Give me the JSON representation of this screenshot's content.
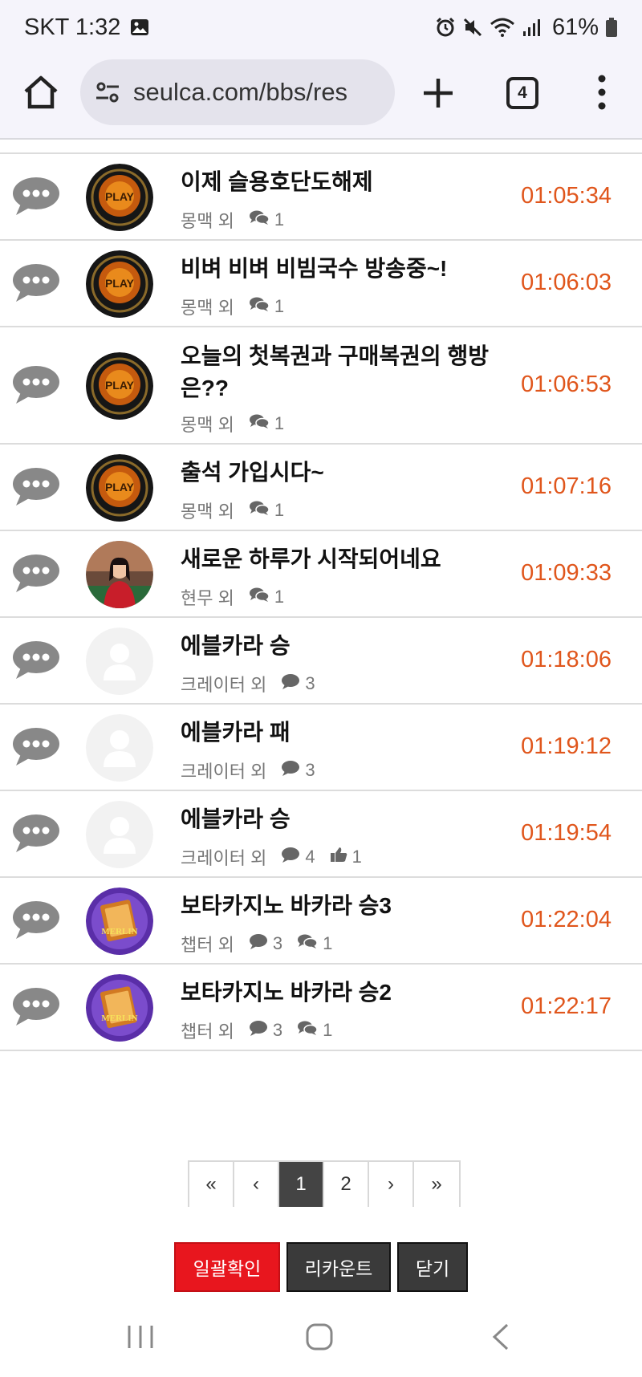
{
  "status_bar": {
    "time": "SKT 1:32",
    "battery": "61%",
    "icons": [
      "gallery-icon",
      "alarm-icon",
      "mute-icon",
      "wifi-icon",
      "signal-icon",
      "battery-icon"
    ]
  },
  "browser": {
    "url": "seulca.com/bbs/res",
    "tab_count": "4"
  },
  "posts": [
    {
      "title": "이제 슬용호단도해제",
      "author": "몽맥 외",
      "comments": "1",
      "comment_icon": "speech-bubbles-icon",
      "extra": null,
      "time": "01:05:34",
      "avatar": "play-logo",
      "height": 108
    },
    {
      "title": "비벼 비벼 비빔국수 방송중~!",
      "author": "몽맥 외",
      "comments": "1",
      "comment_icon": "speech-bubbles-icon",
      "extra": null,
      "time": "01:06:03",
      "avatar": "play-logo",
      "height": 108
    },
    {
      "title": "오늘의 첫복권과 구매복권의 행방은??",
      "author": "몽맥 외",
      "comments": "1",
      "comment_icon": "speech-bubbles-icon",
      "extra": null,
      "time": "01:06:53",
      "avatar": "play-logo",
      "height": 146
    },
    {
      "title": "출석 가입시다~",
      "author": "몽맥 외",
      "comments": "1",
      "comment_icon": "speech-bubbles-icon",
      "extra": null,
      "time": "01:07:16",
      "avatar": "play-logo",
      "height": 108
    },
    {
      "title": "새로운 하루가 시작되어네요",
      "author": "현무 외",
      "comments": "1",
      "comment_icon": "speech-bubbles-icon",
      "extra": null,
      "time": "01:09:33",
      "avatar": "person-photo",
      "height": 108
    },
    {
      "title": "에블카라 승",
      "author": "크레이터 외",
      "comments": "3",
      "comment_icon": "speech-bubble-icon",
      "extra": null,
      "time": "01:18:06",
      "avatar": "default-avatar",
      "height": 108
    },
    {
      "title": "에블카라 패",
      "author": "크레이터 외",
      "comments": "3",
      "comment_icon": "speech-bubble-icon",
      "extra": null,
      "time": "01:19:12",
      "avatar": "default-avatar",
      "height": 108
    },
    {
      "title": "에블카라 승",
      "author": "크레이터 외",
      "comments": "4",
      "comment_icon": "speech-bubble-icon",
      "extra": {
        "icon": "thumbs-up-icon",
        "value": "1"
      },
      "time": "01:19:54",
      "avatar": "default-avatar",
      "height": 108
    },
    {
      "title": "보타카지노 바카라 승3",
      "author": "챕터 외",
      "comments": "3",
      "comment_icon": "speech-bubble-icon",
      "extra": {
        "icon": "speech-bubbles-icon",
        "value": "1"
      },
      "time": "01:22:04",
      "avatar": "merlin-logo",
      "height": 108
    },
    {
      "title": "보타카지노 바카라 승2",
      "author": "챕터 외",
      "comments": "3",
      "comment_icon": "speech-bubble-icon",
      "extra": {
        "icon": "speech-bubbles-icon",
        "value": "1"
      },
      "time": "01:22:17",
      "avatar": "merlin-logo",
      "height": 108
    }
  ],
  "pagination": {
    "first": "«",
    "prev": "‹",
    "pages": [
      "1",
      "2"
    ],
    "current": "1",
    "next": "›",
    "last": "»"
  },
  "actions": {
    "confirm_all": "일괄확인",
    "recount": "리카운트",
    "close": "닫기"
  },
  "colors": {
    "time": "#e0561c",
    "confirm_button": "#e8161e",
    "dark_button": "#3a3a3a",
    "active_page": "#444444"
  }
}
